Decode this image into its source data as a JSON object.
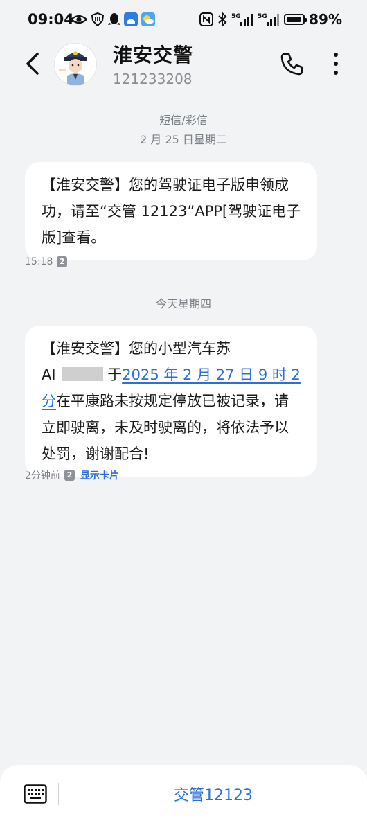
{
  "status_bar": {
    "time": "09:04",
    "battery_text": "89%",
    "battery_level": 0.89,
    "left_icons": [
      "eye-icon",
      "shield-icon",
      "qq-icon",
      "app-icon-blue",
      "weather-icon"
    ],
    "right_icons": [
      "nfc-icon",
      "bluetooth-icon",
      "signal-5g-icon",
      "signal-5g-icon",
      "battery-icon"
    ]
  },
  "header": {
    "name": "淮安交警",
    "number": "121233208"
  },
  "thread": {
    "channel_label": "短信/彩信",
    "first_date": "2 月 25 日星期二",
    "second_date": "今天星期四"
  },
  "messages": [
    {
      "text": "【淮安交警】您的驾驶证电子版申领成功，请至“交管 12123”APP[驾驶证电子版]查看。",
      "time": "15:18",
      "sim": "2"
    },
    {
      "text_before": "【淮安交警】您的小型汽车苏",
      "plate_visible": "AI",
      "text_middle": "于",
      "link_text": "2025 年 2 月 27 日 9 时 2 分",
      "text_after": "在平康路未按规定停放已被记录，请立即驶离，未及时驶离的，将依法予以处罚，谢谢配合!",
      "time": "2分钟前",
      "sim": "2",
      "action": "显示卡片"
    }
  ],
  "bottom": {
    "menu_label": "交管12123"
  },
  "colors": {
    "background": "#f1f3f5",
    "bubble": "#ffffff",
    "accent": "#2b6fd8",
    "meta_text": "#7d8086"
  }
}
